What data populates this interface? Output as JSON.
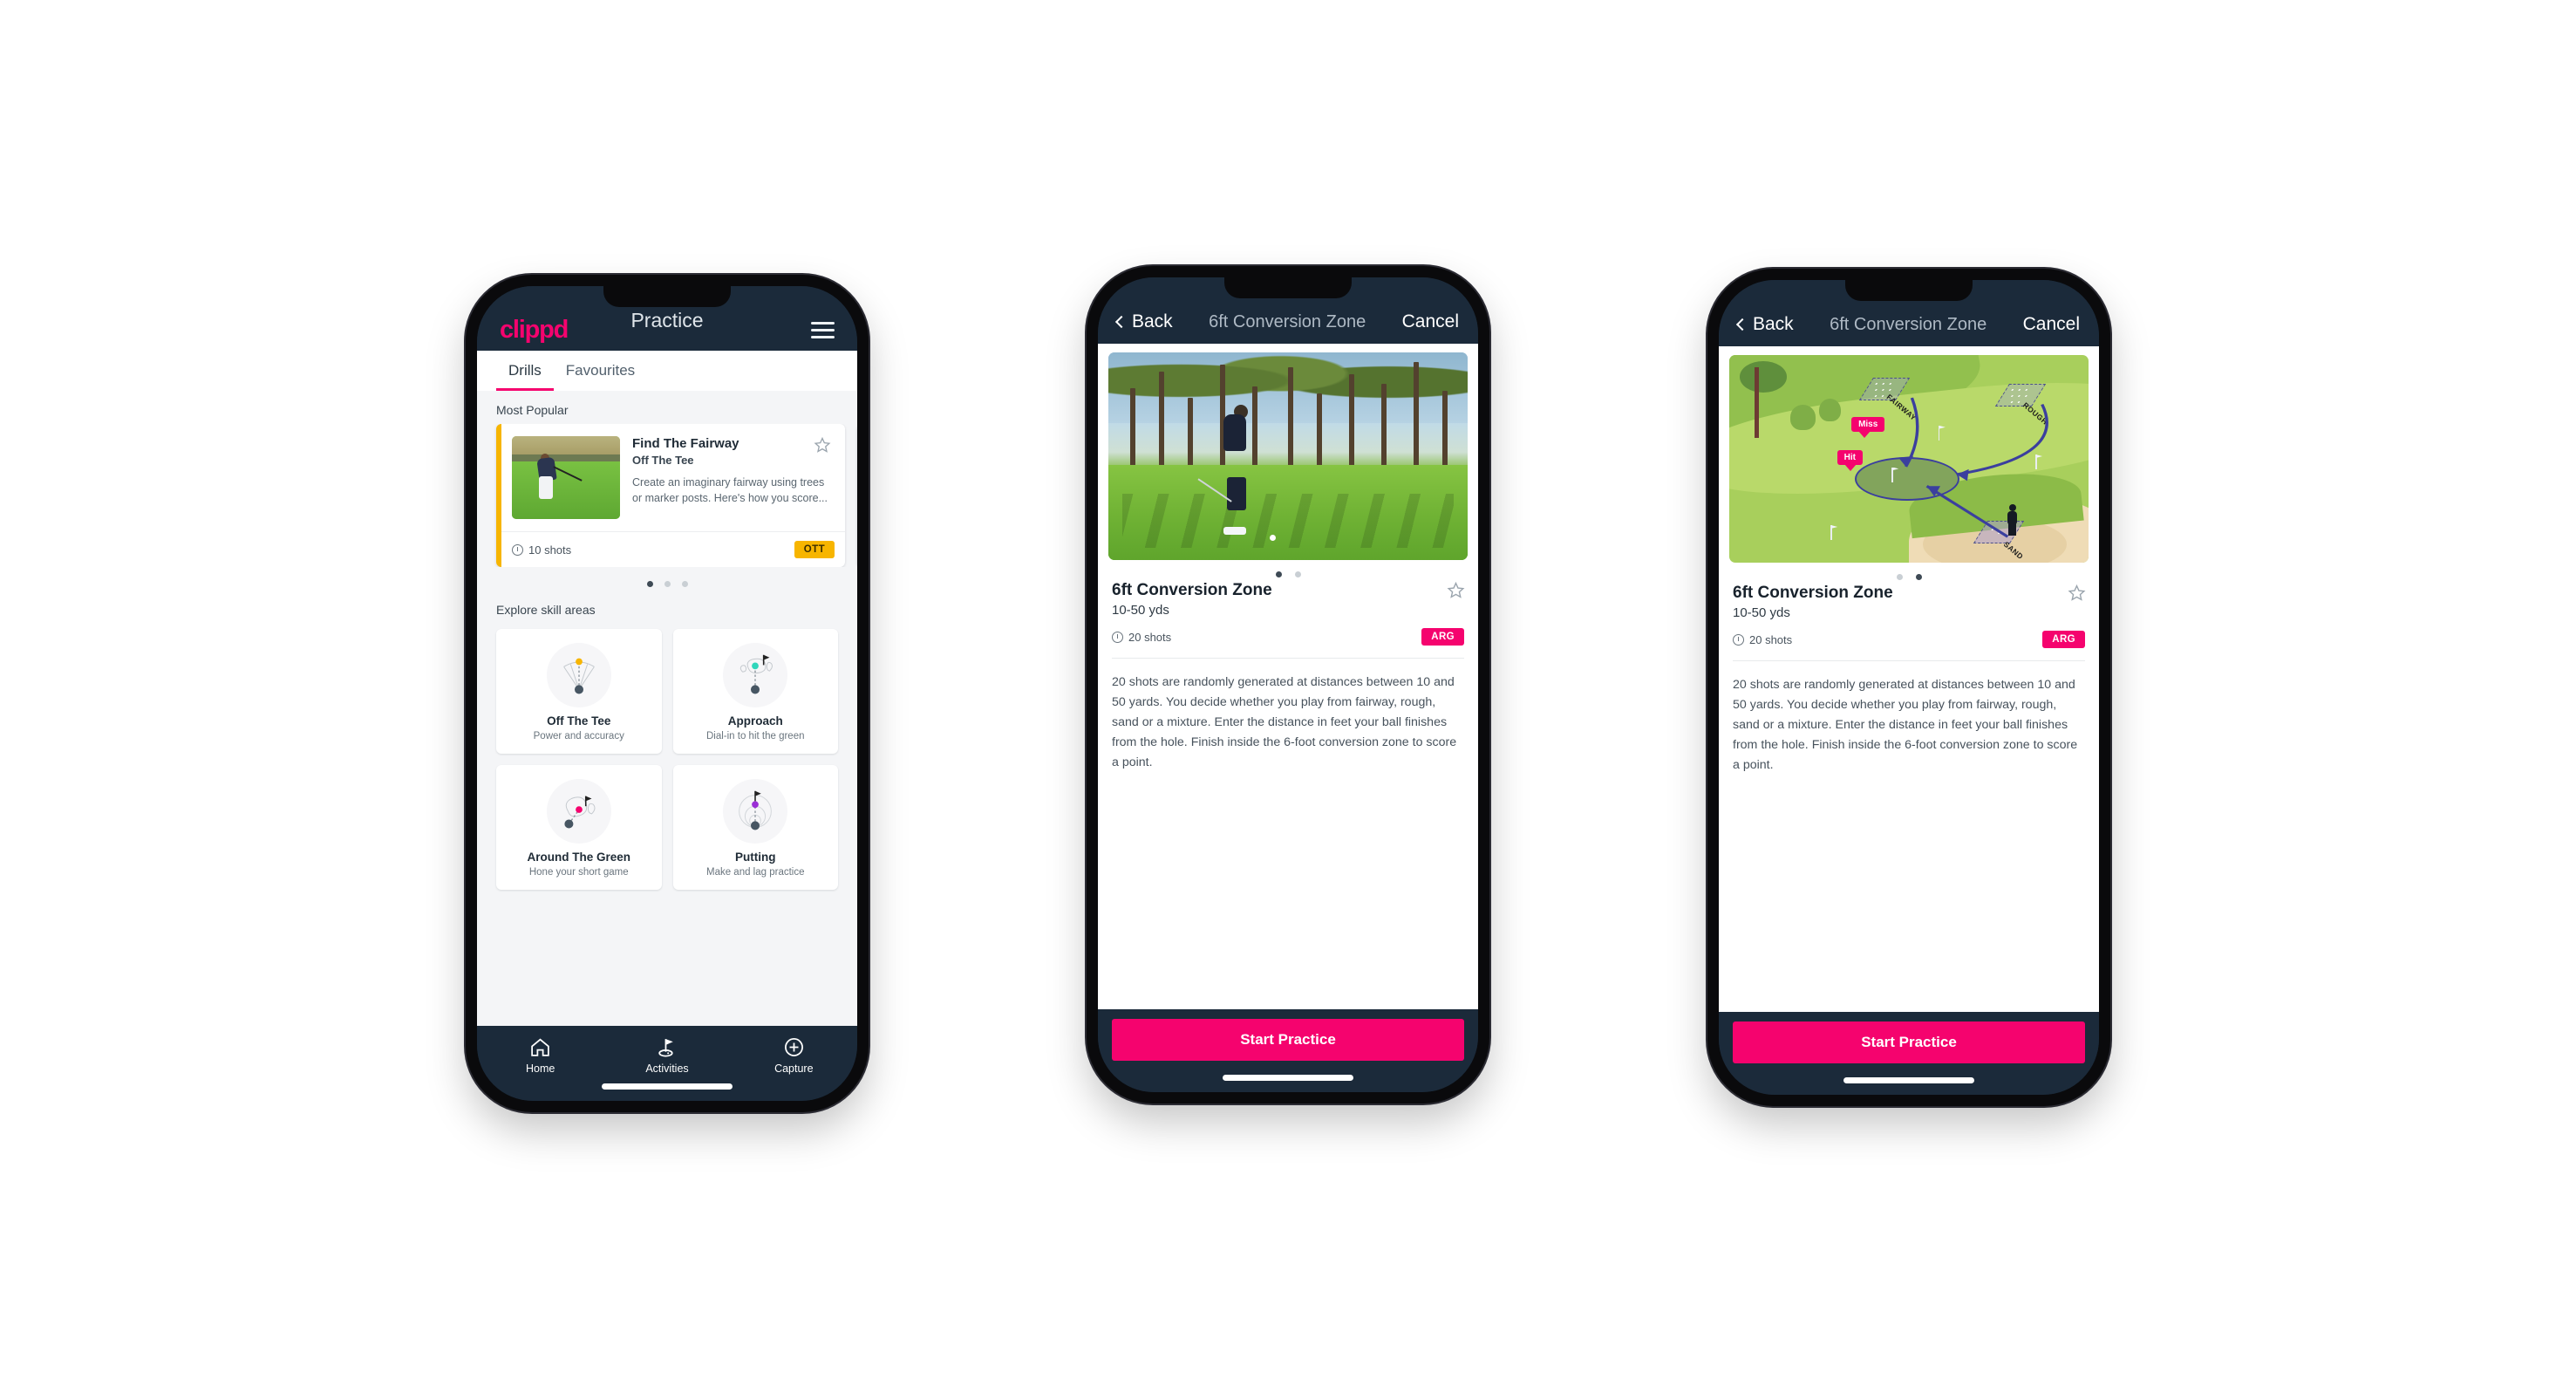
{
  "app": {
    "brand": "clippd",
    "accent_pink": "#f5036e",
    "accent_amber": "#f7b500",
    "accent_teal": "#2fd6bb",
    "header_navy": "#1b2a3a"
  },
  "phone1": {
    "appbar": {
      "title": "Practice",
      "menu_icon": "hamburger-icon"
    },
    "tabs": [
      {
        "label": "Drills",
        "active": true
      },
      {
        "label": "Favourites",
        "active": false
      }
    ],
    "most_popular": {
      "section_label": "Most Popular",
      "card": {
        "title": "Find The Fairway",
        "subtitle": "Off The Tee",
        "description": "Create an imaginary fairway using trees or marker posts. Here's how you score...",
        "shots": "10 shots",
        "badge": "OTT",
        "badge_color": "#f7b500",
        "accent_color": "#f7b500",
        "star_icon": "star-outline-icon",
        "clock_icon": "clock-icon"
      },
      "next_card_accent": "#2fd6bb",
      "dots": {
        "count": 3,
        "active_index": 0
      }
    },
    "explore": {
      "section_label": "Explore skill areas",
      "cards": [
        {
          "name": "Off The Tee",
          "desc": "Power and accuracy",
          "icon": "off-the-tee-icon",
          "dot_color": "#f7b500"
        },
        {
          "name": "Approach",
          "desc": "Dial-in to hit the green",
          "icon": "approach-icon",
          "dot_color": "#2fd6bb"
        },
        {
          "name": "Around The Green",
          "desc": "Hone your short game",
          "icon": "around-the-green-icon",
          "dot_color": "#f5036e"
        },
        {
          "name": "Putting",
          "desc": "Make and lag practice",
          "icon": "putting-icon",
          "dot_color": "#9b2fd6"
        }
      ]
    },
    "tabbar": [
      {
        "label": "Home",
        "icon": "home-icon",
        "active": false
      },
      {
        "label": "Activities",
        "icon": "golf-flag-icon",
        "active": true
      },
      {
        "label": "Capture",
        "icon": "plus-circle-icon",
        "active": false
      }
    ]
  },
  "phone2": {
    "navbar": {
      "back": "Back",
      "title": "6ft Conversion Zone",
      "cancel": "Cancel",
      "back_icon": "chevron-left-icon"
    },
    "media": {
      "type": "photo",
      "alt": "golfer-chipping-photo"
    },
    "dots": {
      "count": 2,
      "active_index": 0
    },
    "detail": {
      "title": "6ft Conversion Zone",
      "yards": "10-50 yds",
      "shots": "20 shots",
      "badge": "ARG",
      "badge_color": "#f5036e",
      "star_icon": "star-outline-icon",
      "clock_icon": "clock-icon",
      "description": "20 shots are randomly generated at distances between 10 and 50 yards. You decide whether you play from fairway, rough, sand or a mixture. Enter the distance in feet your ball finishes from the hole. Finish inside the 6-foot conversion zone to score a point."
    },
    "cta": "Start Practice"
  },
  "phone3": {
    "navbar": {
      "back": "Back",
      "title": "6ft Conversion Zone",
      "cancel": "Cancel",
      "back_icon": "chevron-left-icon"
    },
    "media": {
      "type": "illustration",
      "alt": "golf-course-diagram",
      "zone_labels": [
        "FAIRWAY",
        "ROUGH",
        "SAND"
      ],
      "markers": [
        {
          "label": "Miss",
          "color": "#f5036e"
        },
        {
          "label": "Hit",
          "color": "#f5036e"
        }
      ]
    },
    "dots": {
      "count": 2,
      "active_index": 1
    },
    "detail": {
      "title": "6ft Conversion Zone",
      "yards": "10-50 yds",
      "shots": "20 shots",
      "badge": "ARG",
      "badge_color": "#f5036e",
      "star_icon": "star-outline-icon",
      "clock_icon": "clock-icon",
      "description": "20 shots are randomly generated at distances between 10 and 50 yards. You decide whether you play from fairway, rough, sand or a mixture. Enter the distance in feet your ball finishes from the hole. Finish inside the 6-foot conversion zone to score a point."
    },
    "cta": "Start Practice"
  }
}
